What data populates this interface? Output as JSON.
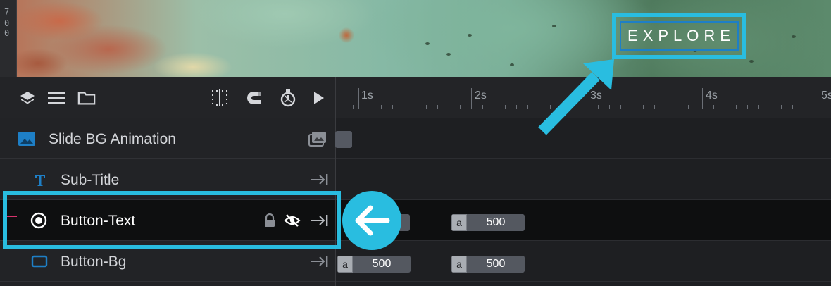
{
  "preview": {
    "ruler_digits": [
      "7",
      "0",
      "0"
    ],
    "button_text": "EXPLORE"
  },
  "toolbar": {
    "icons": [
      "layers-icon",
      "list-icon",
      "folder-icon",
      "grid-snap-icon",
      "magnet-icon",
      "stopwatch-icon",
      "play-icon"
    ]
  },
  "timeline": {
    "tick_labels": [
      "1s",
      "2s",
      "3s",
      "4s",
      "5s"
    ]
  },
  "layers": [
    {
      "label": "Slide BG Animation",
      "icon": "image-icon",
      "trail_icon": "images-icon",
      "selected": false
    },
    {
      "label": "Sub-Title",
      "icon": "text-icon",
      "trail_icon": "align-end-icon",
      "selected": false
    },
    {
      "label": "Button-Text",
      "icon": "radio-dot-icon",
      "trail_icon": "align-end-icon",
      "selected": true,
      "extra_icons": [
        "lock-icon",
        "eye-off-icon"
      ]
    },
    {
      "label": "Button-Bg",
      "icon": "rectangle-icon",
      "trail_icon": "align-end-icon",
      "selected": false
    }
  ],
  "frames": {
    "button_text": [
      {
        "prefix": "",
        "value": ""
      },
      {
        "prefix": "a",
        "value": "500"
      }
    ],
    "button_bg": [
      {
        "prefix": "a",
        "value": "500"
      },
      {
        "prefix": "a",
        "value": "500"
      }
    ]
  },
  "colors": {
    "highlight": "#29bde0",
    "accent_blue": "#1e7fc6",
    "marker_pink": "#d6336c"
  }
}
